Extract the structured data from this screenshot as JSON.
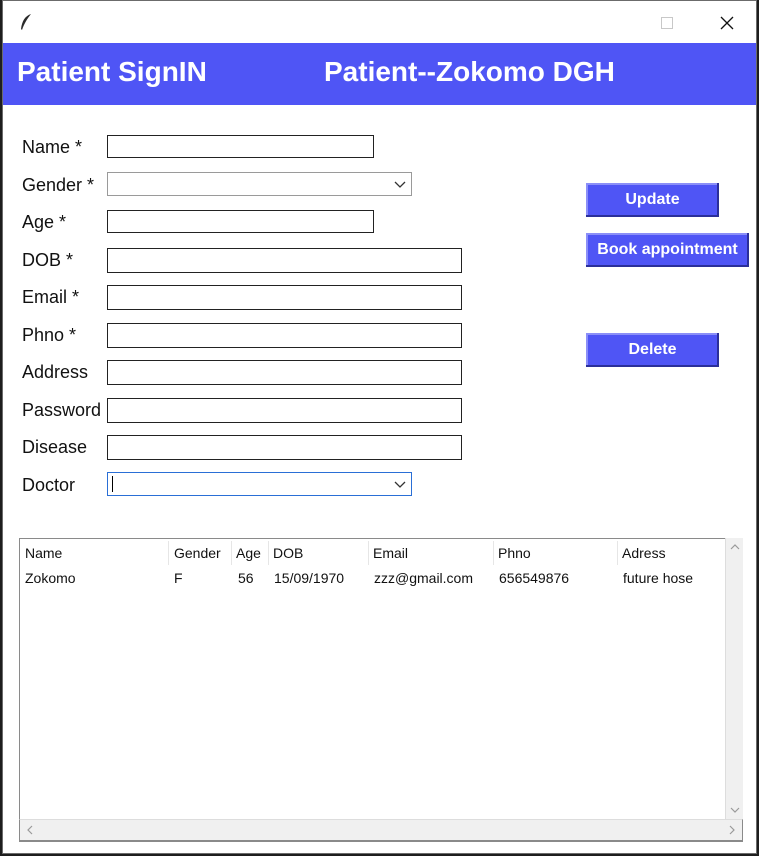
{
  "window": {
    "icon": "feather-icon",
    "controls": [
      "minimize-icon",
      "maximize-icon",
      "close-icon"
    ]
  },
  "header": {
    "left_title": "Patient SignIN",
    "right_title": "Patient--Zokomo  DGH",
    "color": "#4f55f5"
  },
  "form": {
    "name_label": "Name *",
    "gender_label": "Gender *",
    "age_label": "Age *",
    "dob_label": "DOB *",
    "email_label": "Email *",
    "phno_label": "Phno *",
    "address_label": "Address",
    "password_label": "Password",
    "disease_label": "Disease",
    "doctor_label": "Doctor",
    "name_value": "",
    "gender_value": "",
    "age_value": "",
    "dob_value": "",
    "email_value": "",
    "phno_value": "",
    "address_value": "",
    "password_value": "",
    "disease_value": "",
    "doctor_value": ""
  },
  "buttons": {
    "update": "Update",
    "book": "Book appointment",
    "delete": "Delete"
  },
  "table": {
    "columns": [
      "Name",
      "Gender",
      "Age",
      "DOB",
      "Email",
      "Phno",
      "Adress"
    ],
    "rows": [
      [
        "Zokomo",
        "F",
        "56",
        "15/09/1970",
        "zzz@gmail.com",
        "656549876",
        "future hose"
      ]
    ]
  }
}
